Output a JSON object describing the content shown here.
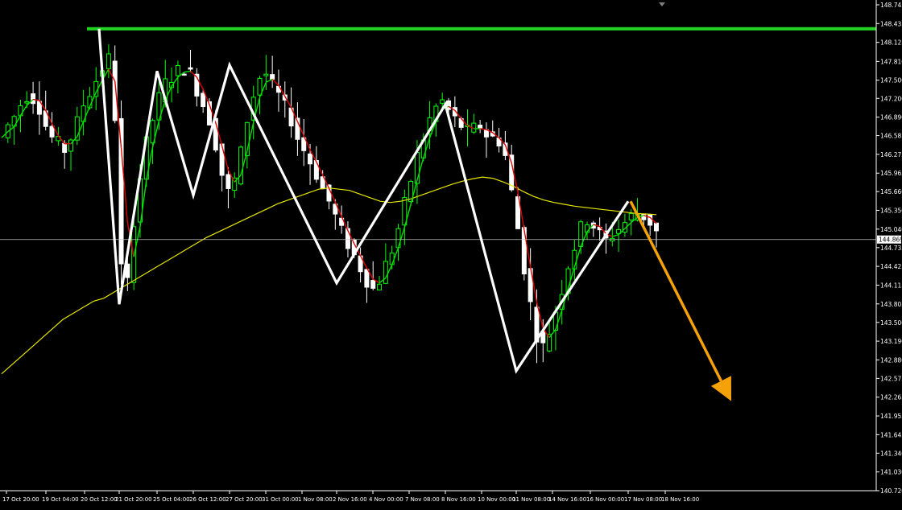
{
  "colors": {
    "background": "#000000",
    "bull_candle": "#00ff00",
    "bear_candle": "#ffffff",
    "axis_text": "#ffffff",
    "current_price_box": "#ffffff",
    "current_price_line": "#c0c0c0",
    "fast_ma_up": "#00e000",
    "fast_ma_down": "#e00000",
    "slow_ma": "#e6e600",
    "resistance_line": "#22d422",
    "zigzag": "#ffffff",
    "forecast_arrow": "#f5a10a"
  },
  "icons": {
    "scroll_marker": "chart-shift-triangle-icon"
  },
  "chart_data": {
    "type": "candlestick",
    "symbol": "",
    "price_axis_ticks": [
      "148.745",
      "148.435",
      "148.125",
      "147.810",
      "147.500",
      "147.200",
      "146.890",
      "146.585",
      "146.275",
      "145.965",
      "145.660",
      "145.350",
      "145.040",
      "144.735",
      "144.425",
      "144.115",
      "143.805",
      "143.500",
      "143.190",
      "142.880",
      "142.575",
      "142.265",
      "141.955",
      "141.645",
      "141.340",
      "141.030",
      "140.720"
    ],
    "ylim": [
      140.72,
      148.745
    ],
    "time_axis_ticks": [
      "17 Oct 20:00",
      "19 Oct 04:00",
      "20 Oct 12:00",
      "21 Oct 20:00",
      "25 Oct 04:00",
      "26 Oct 12:00",
      "27 Oct 20:00",
      "31 Oct 00:00",
      "1 Nov 08:00",
      "2 Nov 16:00",
      "4 Nov 00:00",
      "7 Nov 08:00",
      "8 Nov 16:00",
      "10 Nov 00:00",
      "11 Nov 08:00",
      "14 Nov 16:00",
      "16 Nov 00:00",
      "17 Nov 08:00",
      "18 Nov 16:00"
    ],
    "current_price": "144.869",
    "close_path": [
      146.55,
      146.75,
      146.9,
      147.1,
      147.25,
      147.2,
      147.05,
      146.75,
      146.55,
      146.45,
      146.35,
      146.55,
      146.8,
      147.1,
      147.3,
      147.5,
      147.7,
      147.85,
      146.9,
      144.4,
      144.15,
      145.2,
      145.9,
      146.45,
      146.85,
      147.2,
      147.45,
      147.55,
      147.65,
      147.7,
      147.6,
      147.35,
      147.1,
      146.85,
      146.45,
      145.95,
      145.65,
      145.85,
      146.3,
      146.85,
      147.25,
      147.55,
      147.6,
      147.4,
      147.25,
      147.05,
      146.85,
      146.55,
      146.35,
      146.15,
      145.95,
      145.7,
      145.5,
      145.25,
      145.0,
      144.8,
      144.6,
      144.4,
      144.2,
      144.05,
      144.2,
      144.45,
      144.7,
      145.05,
      145.45,
      145.85,
      146.25,
      146.55,
      146.85,
      147.05,
      147.15,
      147.0,
      146.85,
      146.75,
      146.65,
      146.7,
      146.75,
      146.6,
      146.55,
      146.5,
      146.25,
      145.65,
      145.05,
      144.4,
      143.8,
      143.3,
      143.1,
      143.35,
      143.7,
      144.05,
      144.45,
      144.75,
      145.05,
      145.2,
      145.1,
      144.95,
      144.85,
      144.95,
      145.05,
      145.15,
      145.25,
      145.3,
      145.25,
      145.15,
      145.0
    ],
    "slow_ma_path": [
      142.65,
      142.8,
      142.95,
      143.1,
      143.25,
      143.4,
      143.55,
      143.65,
      143.75,
      143.85,
      143.9,
      144.0,
      144.1,
      144.2,
      144.3,
      144.4,
      144.5,
      144.6,
      144.7,
      144.8,
      144.9,
      144.98,
      145.06,
      145.14,
      145.22,
      145.3,
      145.38,
      145.46,
      145.52,
      145.58,
      145.64,
      145.7,
      145.72,
      145.7,
      145.68,
      145.62,
      145.56,
      145.5,
      145.48,
      145.5,
      145.54,
      145.6,
      145.66,
      145.72,
      145.78,
      145.83,
      145.87,
      145.9,
      145.88,
      145.82,
      145.75,
      145.66,
      145.58,
      145.52,
      145.48,
      145.45,
      145.42,
      145.4,
      145.38,
      145.36,
      145.34,
      145.32,
      145.3,
      145.29,
      145.28
    ],
    "resistance_level": 148.35,
    "zigzag_points": [
      {
        "time": "20 Oct 12:00",
        "price": 148.35
      },
      {
        "time": "21 Oct 20:00",
        "price": 143.8
      },
      {
        "time": "25 Oct 04:00",
        "price": 147.65
      },
      {
        "time": "26 Oct 12:00",
        "price": 145.6
      },
      {
        "time": "27 Oct 20:00",
        "price": 147.75
      },
      {
        "time": "2 Nov 16:00",
        "price": 144.15
      },
      {
        "time": "8 Nov 16:00",
        "price": 147.1
      },
      {
        "time": "11 Nov 08:00",
        "price": 142.7
      },
      {
        "time": "17 Nov 08:00",
        "price": 145.5
      }
    ],
    "forecast_arrow": {
      "from_time": "17 Nov 08:00",
      "from_price": 145.5,
      "to_price": 142.2,
      "direction": "down"
    }
  }
}
